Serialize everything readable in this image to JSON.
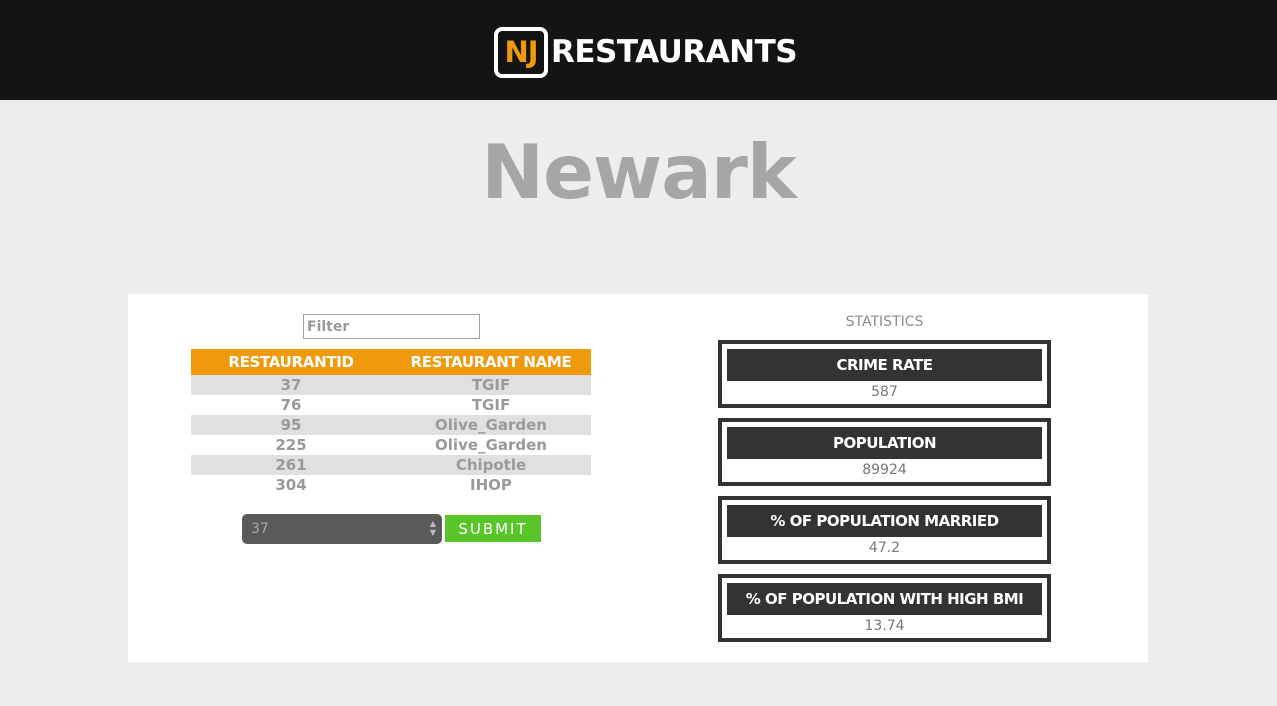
{
  "header": {
    "logo_badge": "NJ",
    "logo_text": "RESTAURANTS"
  },
  "page": {
    "title": "Newark"
  },
  "filter": {
    "placeholder": "Filter"
  },
  "table": {
    "columns": [
      "RESTAURANTID",
      "RESTAURANT NAME"
    ],
    "rows": [
      {
        "id": "37",
        "name": "TGIF"
      },
      {
        "id": "76",
        "name": "TGIF"
      },
      {
        "id": "95",
        "name": "Olive_Garden"
      },
      {
        "id": "225",
        "name": "Olive_Garden"
      },
      {
        "id": "261",
        "name": "Chipotle"
      },
      {
        "id": "304",
        "name": "IHOP"
      }
    ]
  },
  "select": {
    "value": "37"
  },
  "submit": {
    "label": "SUBMIT"
  },
  "stats": {
    "title": "STATISTICS",
    "items": [
      {
        "label": "CRIME RATE",
        "value": "587"
      },
      {
        "label": "POPULATION",
        "value": "89924"
      },
      {
        "label": "% OF POPULATION MARRIED",
        "value": "47.2"
      },
      {
        "label": "% OF POPULATION WITH HIGH BMI",
        "value": "13.74"
      }
    ]
  },
  "colors": {
    "brand_orange": "#ef9a0d",
    "header_bg": "#141414",
    "submit_green": "#5ac52a",
    "card_dark": "#333333"
  }
}
